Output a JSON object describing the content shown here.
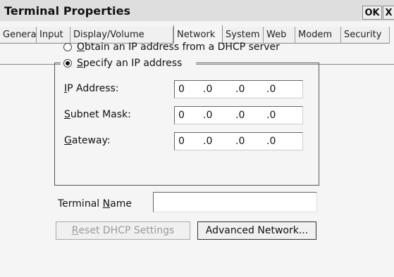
{
  "window": {
    "title": "Terminal Properties",
    "ok_label": "OK",
    "close_label": "X"
  },
  "tabs": [
    {
      "label": "General",
      "active": false
    },
    {
      "label": "Input",
      "active": false
    },
    {
      "label": "Display/Volume",
      "active": false
    },
    {
      "label": "Network",
      "active": true
    },
    {
      "label": "System",
      "active": false
    },
    {
      "label": "Web",
      "active": false
    },
    {
      "label": "Modem",
      "active": false
    },
    {
      "label": "Security",
      "active": false
    }
  ],
  "network": {
    "dhcp_option": {
      "accel": "O",
      "rest": "btain an IP address from a DHCP server",
      "checked": false
    },
    "static_option": {
      "accel": "S",
      "rest": "pecify an IP address",
      "checked": true
    },
    "fields": [
      {
        "accel": "I",
        "rest": "P Address:",
        "octets": [
          "0",
          ".0",
          ".0",
          ".0"
        ]
      },
      {
        "accel": "S",
        "rest": "ubnet Mask:",
        "octets": [
          "0",
          ".0",
          ".0",
          ".0"
        ]
      },
      {
        "accel": "G",
        "rest": "ateway:",
        "octets": [
          "0",
          ".0",
          ".0",
          ".0"
        ]
      }
    ],
    "terminal_name": {
      "prefix": "Terminal ",
      "accel": "N",
      "rest": "ame",
      "value": ""
    },
    "reset_button": {
      "accel": "R",
      "rest": "eset DHCP Settings",
      "enabled": false
    },
    "advanced_button": {
      "label": "Advanced Network..."
    }
  }
}
